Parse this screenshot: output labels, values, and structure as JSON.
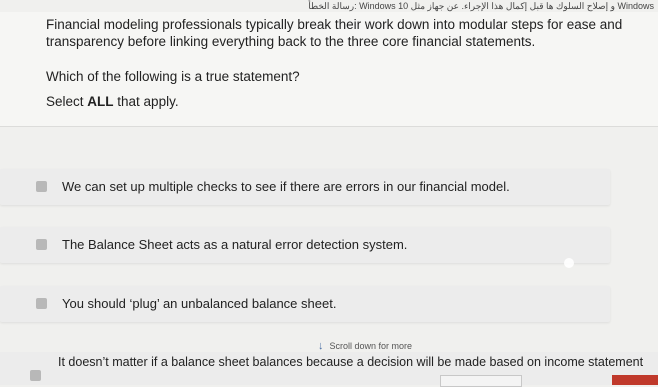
{
  "topbar": {
    "text": "رسالة الخطأ: Windows 10 و إصلاح السلوك ها قبل إكمال هذا الإجراء. عن جهاز مثل Windows"
  },
  "question": {
    "intro": "Financial modeling professionals typically break their work down into modular steps for ease and transparency before linking everything back to the three core financial statements.",
    "prompt": "Which of the following is a true statement?",
    "select_prefix": "Select ",
    "select_bold": "ALL",
    "select_suffix": " that apply."
  },
  "options": [
    {
      "label": "We can set up multiple checks to see if there are errors in our financial model."
    },
    {
      "label": "The Balance Sheet acts as a natural error detection system."
    },
    {
      "label": "You should ‘plug’ an unbalanced balance sheet."
    },
    {
      "label": "It doesn’t matter if a balance sheet balances because a decision will be made based on income statement"
    }
  ],
  "scroll_hint": {
    "arrow": "↓",
    "label": "Scroll down for more"
  }
}
